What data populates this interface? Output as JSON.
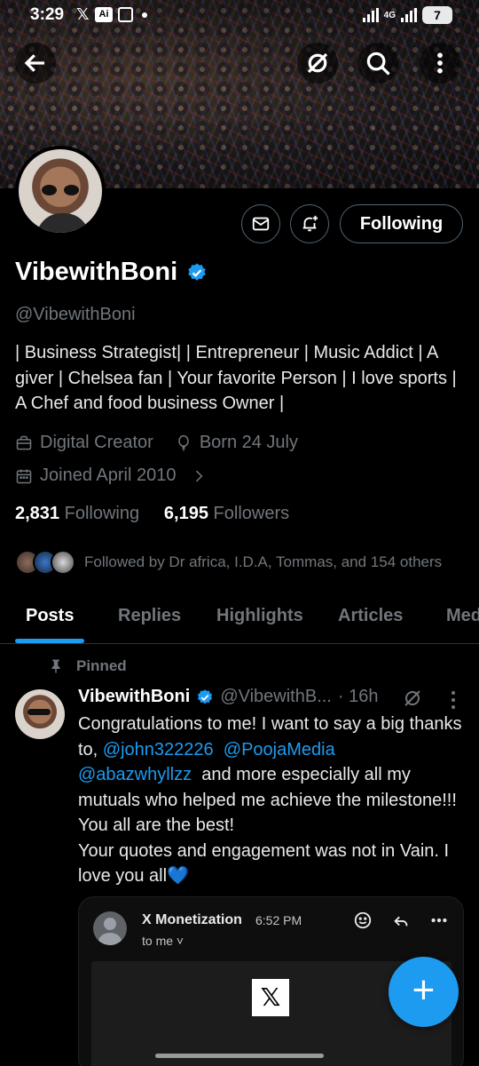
{
  "status_bar": {
    "time": "3:29",
    "network": "4G",
    "battery": "7"
  },
  "profile": {
    "name": "VibewithBoni",
    "handle": "@VibewithBoni",
    "bio": "| Business Strategist| | Entrepreneur | Music Addict | A giver | Chelsea fan | Your favorite Person | I love sports | A Chef and food business Owner |",
    "category": "Digital Creator",
    "born": "Born 24 July",
    "joined": "Joined April 2010",
    "following_count": "2,831",
    "following_label": "Following",
    "followers_count": "6,195",
    "followers_label": "Followers",
    "followed_by": "Followed by Dr africa, I.D.A, Tommas, and 154 others",
    "follow_button_label": "Following"
  },
  "tabs": [
    "Posts",
    "Replies",
    "Highlights",
    "Articles",
    "Media"
  ],
  "pinned_post": {
    "pinned_label": "Pinned",
    "author_name": "VibewithBoni",
    "author_handle": "@VibewithB...",
    "time": "· 16h",
    "text_line1": "Congratulations to me! I want to say a big thanks to, ",
    "mention1": "@john322226",
    "mention2": "@PoojaMedia",
    "mention3": "@abazwhyllzz",
    "text_rest": "and more especially all my mutuals who helped me achieve the milestone!!! You all are the best!",
    "text_line2": "Your quotes and engagement was not in Vain.  I love you all💙",
    "embed": {
      "from": "X Monetization",
      "time": "6:52 PM",
      "to": "to me ˅",
      "logo": "𝕏"
    }
  },
  "fab_label": "+",
  "colors": {
    "accent": "#1d9bf0",
    "background": "#000000",
    "muted": "#71767b"
  }
}
